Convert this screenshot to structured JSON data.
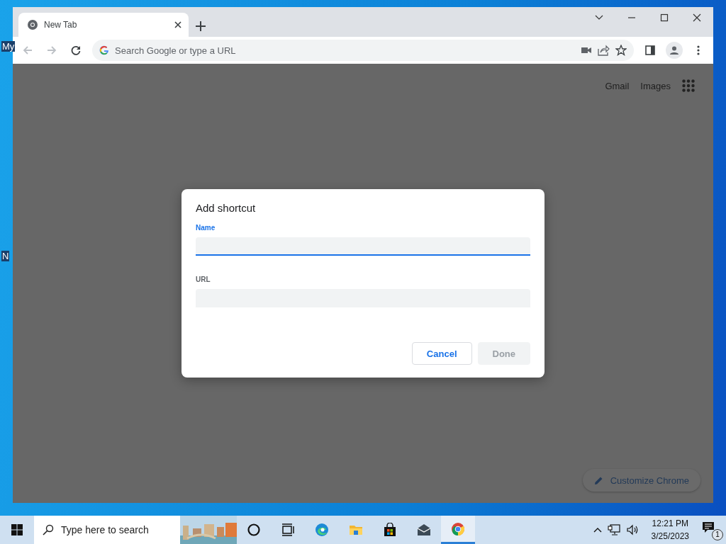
{
  "desktop": {
    "icon_labels": [
      "My",
      "N"
    ]
  },
  "browser": {
    "tabs": [
      {
        "title": "New Tab",
        "selected": true
      }
    ],
    "omnibox": {
      "placeholder": "Search Google or type a URL"
    }
  },
  "page": {
    "links": [
      "Gmail",
      "Images"
    ],
    "customize_button": "Customize Chrome"
  },
  "dialog": {
    "title": "Add shortcut",
    "fields": [
      {
        "label": "Name",
        "focused": true
      },
      {
        "label": "URL",
        "focused": false
      }
    ],
    "buttons": [
      {
        "label": "Cancel",
        "disabled": false
      },
      {
        "label": "Done",
        "disabled": true
      }
    ]
  },
  "taskbar": {
    "search": {
      "placeholder": "Type here to search"
    },
    "apps": [
      {
        "kind": "cortana",
        "active": false
      },
      {
        "kind": "taskview",
        "active": false
      },
      {
        "kind": "edge",
        "active": false
      },
      {
        "kind": "explorer",
        "active": false
      },
      {
        "kind": "store",
        "active": false
      },
      {
        "kind": "mail",
        "active": false
      },
      {
        "kind": "chrome",
        "active": true
      }
    ],
    "time": "12:21 PM",
    "date": "3/25/2023",
    "notification_count": "1"
  }
}
